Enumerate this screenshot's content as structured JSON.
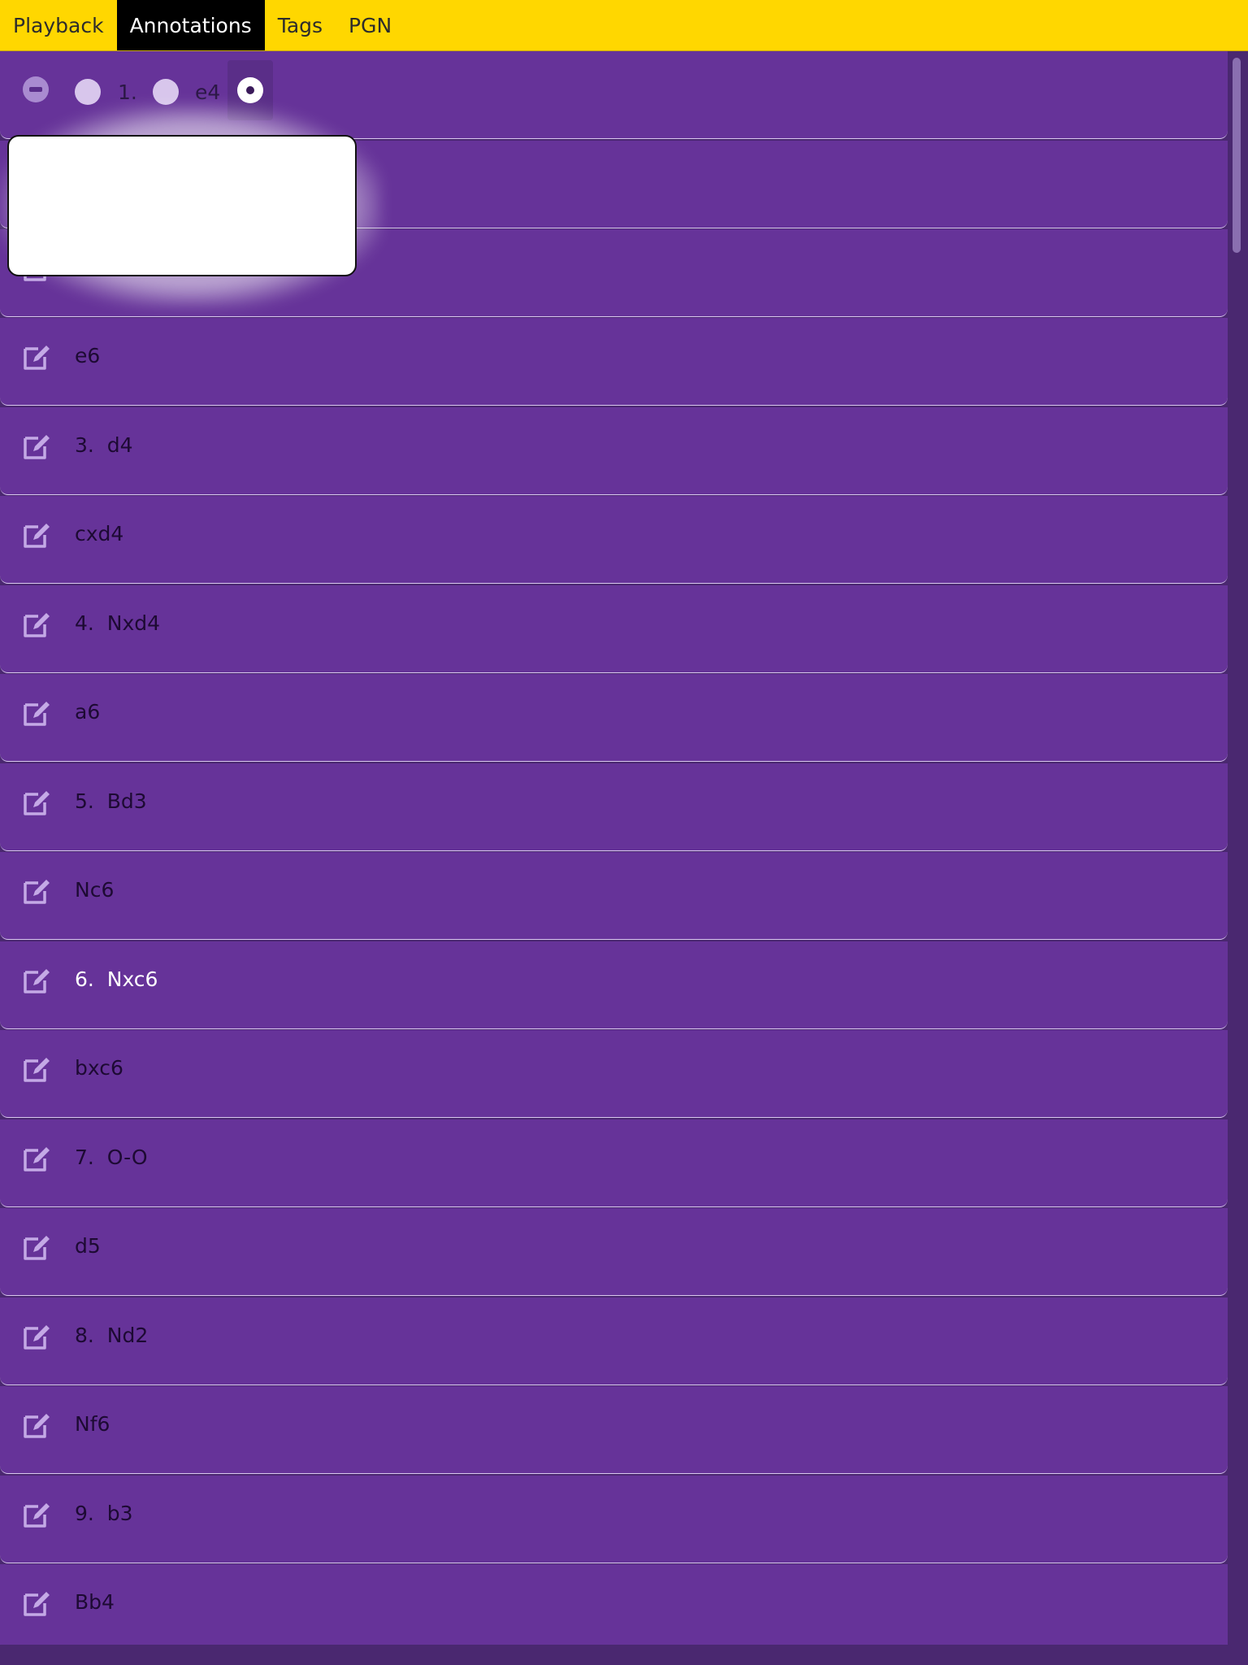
{
  "tabs": [
    {
      "label": "Playback"
    },
    {
      "label": "Annotations"
    },
    {
      "label": "Tags"
    },
    {
      "label": "PGN"
    }
  ],
  "first_row": {
    "move_number": "1.",
    "move": "e4"
  },
  "moves": [
    {
      "label": "e6"
    },
    {
      "label": "3.  d4"
    },
    {
      "label": "cxd4"
    },
    {
      "label": "4.  Nxd4"
    },
    {
      "label": "a6"
    },
    {
      "label": "5.  Bd3"
    },
    {
      "label": "Nc6"
    },
    {
      "label": "6.  Nxc6"
    },
    {
      "label": "bxc6"
    },
    {
      "label": "7.  O-O"
    },
    {
      "label": "d5"
    },
    {
      "label": "8.  Nd2"
    },
    {
      "label": "Nf6"
    },
    {
      "label": "9.  b3"
    },
    {
      "label": "Bb4"
    }
  ],
  "colors": {
    "tab_bar": "#ffd700",
    "row_bg": "#663399",
    "active_tab": "#000000"
  },
  "icons": {
    "edit": "edit-icon",
    "minus": "minus-circle-icon",
    "radio": "radio-icon"
  }
}
